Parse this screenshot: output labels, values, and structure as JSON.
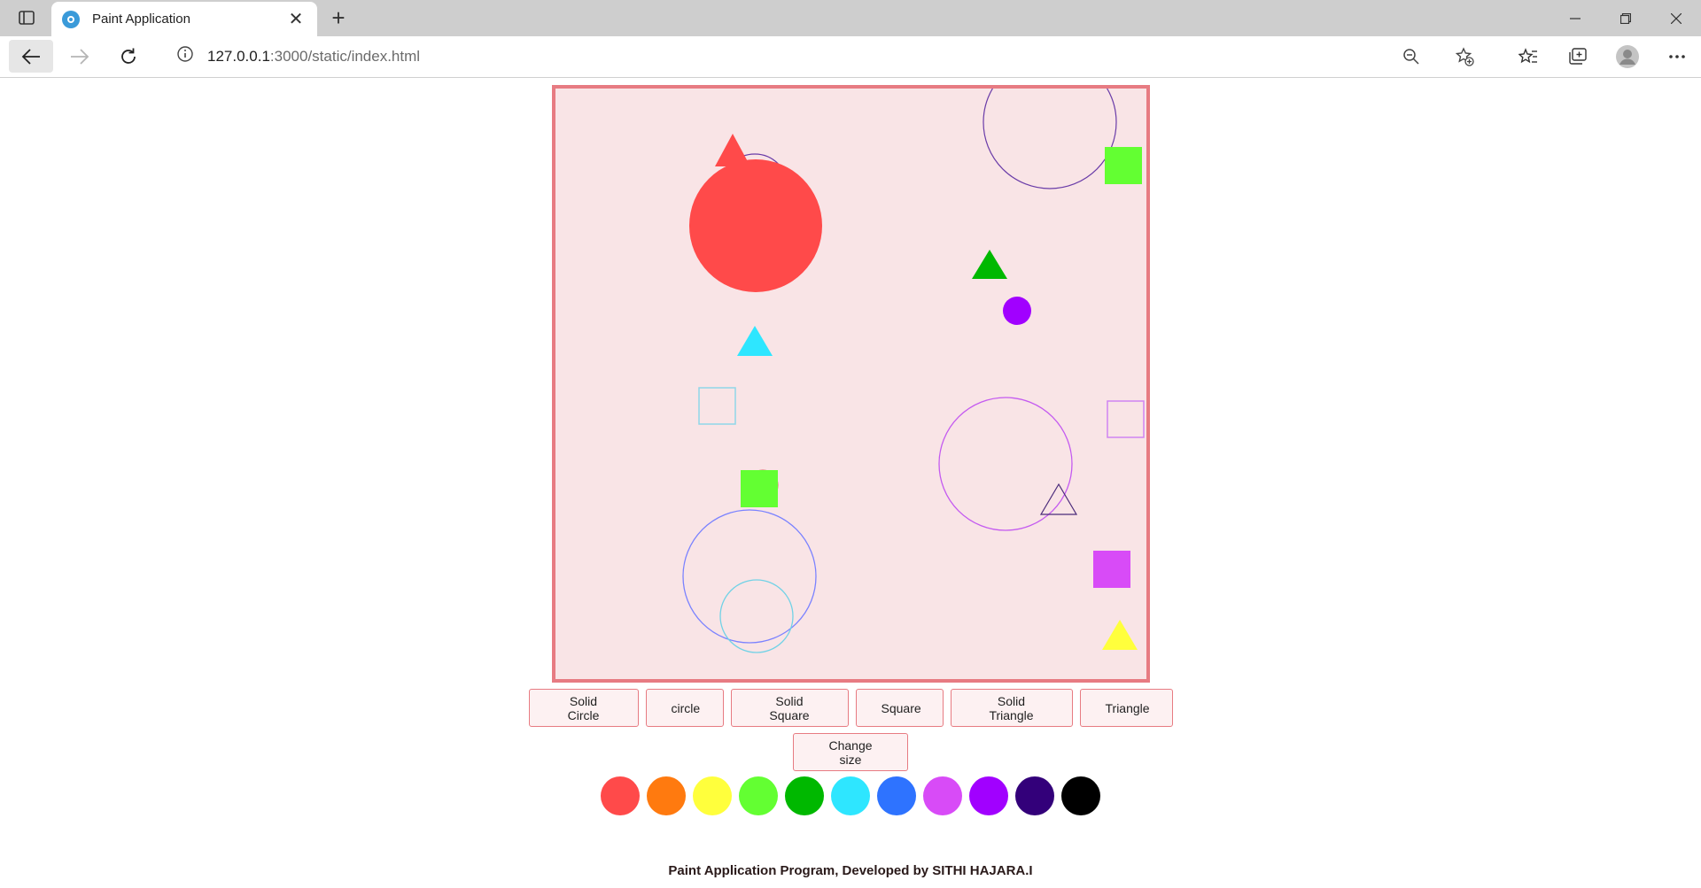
{
  "browser": {
    "tab_title": "Paint Application",
    "address_host": "127.0.0.1",
    "address_rest": ":3000/static/index.html"
  },
  "buttons": {
    "solid_circle": "Solid Circle",
    "circle": "circle",
    "solid_square": "Solid Square",
    "square": "Square",
    "solid_triangle": "Solid Triangle",
    "triangle": "Triangle",
    "change_size": "Change size"
  },
  "palette": [
    "#ff4a4a",
    "#ff7a0f",
    "#ffff3c",
    "#63ff32",
    "#00b800",
    "#2ee6ff",
    "#2e73ff",
    "#d84bf7",
    "#a100ff",
    "#33007a",
    "#000000"
  ],
  "footer": "Paint Application Program, Developed by SITHI HAJARA.I",
  "colors": {
    "canvas_bg": "#f9e4e6",
    "canvas_border": "#e77b82",
    "button_bg": "#fdf1f2",
    "button_border": "#e77b82"
  }
}
